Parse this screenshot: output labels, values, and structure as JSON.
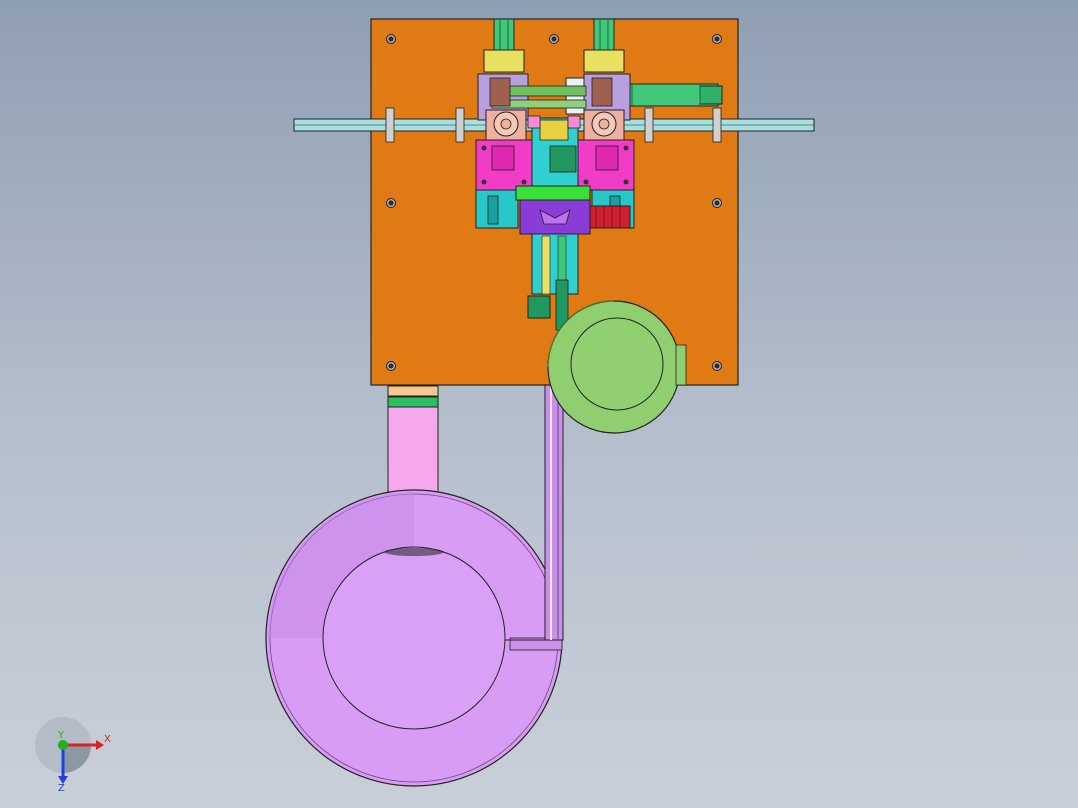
{
  "triad": {
    "x_label": "X",
    "y_label": "Y",
    "z_label": "Z",
    "x_color": "#e02020",
    "y_color": "#20b020",
    "z_color": "#2040e0"
  },
  "colors": {
    "background_top": "#8f9fb3",
    "background_bottom": "#c9cfd8",
    "mounting_plate": "#e07a14",
    "large_bowl_feeder": "#d99cf5",
    "small_bowl_feeder": "#8fcf70",
    "feed_track": "#c890e8",
    "pink_block": "#f23cc8",
    "cyan_block": "#28c8c8",
    "cylinder": "#40c878",
    "purple_block": "#8a3cd8",
    "red_block": "#d02030"
  }
}
